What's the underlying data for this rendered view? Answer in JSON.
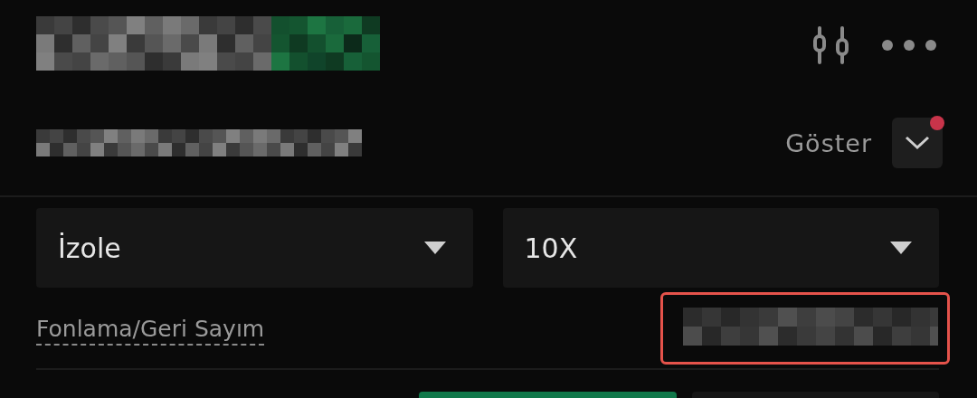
{
  "display_toggle": {
    "label": "Göster",
    "notification": true
  },
  "selects": [
    {
      "value": "İzole"
    },
    {
      "value": "10X"
    }
  ],
  "funding": {
    "label": "Fonlama/Geri Sayım",
    "highlighted": true
  }
}
